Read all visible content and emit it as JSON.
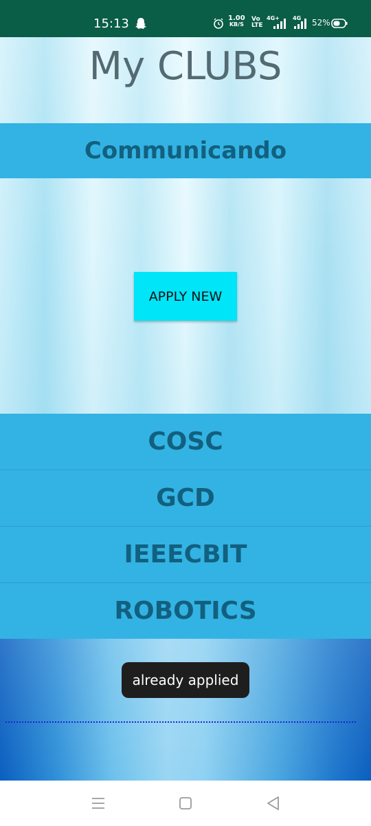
{
  "status_bar": {
    "time": "15:13",
    "network_speed_value": "1.00",
    "network_speed_unit": "KB/S",
    "volte_top": "Vo",
    "volte_bottom": "LTE",
    "signal1_label": "4G+",
    "signal2_label": "4G",
    "battery_percent": "52%",
    "icons": [
      "snapchat-icon",
      "alarm-icon",
      "signal-icon",
      "battery-icon"
    ]
  },
  "page": {
    "title": "My CLUBS",
    "current_club": "Communicando",
    "apply_button_label": "APPLY NEW"
  },
  "clubs": [
    {
      "label": "COSC"
    },
    {
      "label": "GCD"
    },
    {
      "label": "IEEECBIT"
    },
    {
      "label": "ROBOTICS"
    }
  ],
  "toast": {
    "message": "already applied"
  },
  "nav_bar": {
    "icons": [
      "menu-icon",
      "home-icon",
      "back-icon"
    ]
  },
  "colors": {
    "status_bar": "#0a5d47",
    "club_bar": "#33b3e3",
    "club_text": "#12607f",
    "apply_button": "#00e5f8",
    "title_text": "#546a72",
    "toast_bg": "#1e1e1e"
  }
}
